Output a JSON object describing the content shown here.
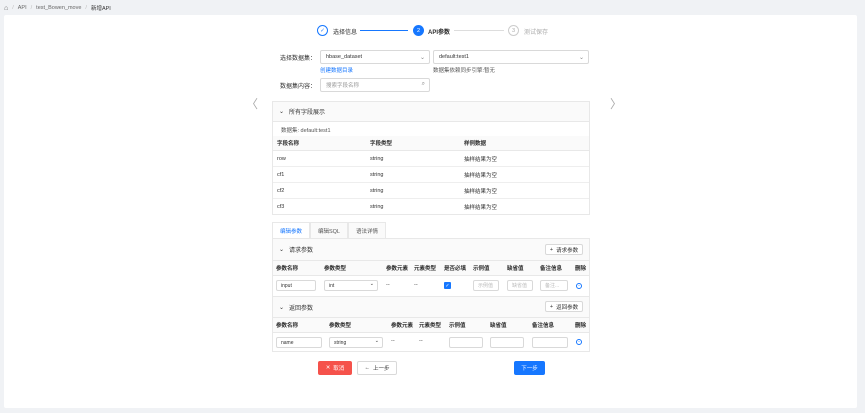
{
  "breadcrumb": {
    "items": [
      "API",
      "test_Bowen_move",
      "新增API"
    ]
  },
  "steps": [
    {
      "num": "✓",
      "label": "选择信息",
      "state": "done"
    },
    {
      "num": "2",
      "label": "API参数",
      "state": "active"
    },
    {
      "num": "3",
      "label": "测试保存",
      "state": "todo"
    }
  ],
  "form": {
    "dataset_label": "选择数据集：",
    "dataset_value": "hbase_dataset",
    "table_value": "default:test1",
    "create_link": "创建数据目录",
    "sync_hint": "数据集依赖同步引擎:暂无",
    "content_label": "数据集内容：",
    "search_placeholder": "搜索字段名称"
  },
  "fields_panel": {
    "title": "所有字段展示",
    "dataset_line": "数据集: default:test1",
    "columns": [
      "字段名称",
      "字段类型",
      "样例数据"
    ],
    "rows": [
      [
        "row",
        "string",
        "抽样结果为空"
      ],
      [
        "cf1",
        "string",
        "抽样结果为空"
      ],
      [
        "cf2",
        "string",
        "抽样结果为空"
      ],
      [
        "cf3",
        "string",
        "抽样结果为空"
      ]
    ]
  },
  "tabs": [
    "编辑参数",
    "编辑SQL",
    "语法详情"
  ],
  "request": {
    "title": "请求参数",
    "add_label": "请求参数",
    "columns": [
      "参数名称",
      "参数类型",
      "参数元素",
      "元素类型",
      "是否必填",
      "示例值",
      "缺省值",
      "备注信息",
      "删除"
    ],
    "row": {
      "name": "input",
      "type": "int",
      "elem": "--",
      "elem_type": "--",
      "example_ph": "示例值",
      "default_ph": "缺省值",
      "note_ph": "备注..."
    }
  },
  "response": {
    "title": "返回参数",
    "add_label": "返回参数",
    "columns": [
      "参数名称",
      "参数类型",
      "参数元素",
      "元素类型",
      "示例值",
      "缺省值",
      "备注信息",
      "删除"
    ],
    "row": {
      "name": "name",
      "type": "string",
      "elem": "--",
      "elem_type": "--"
    }
  },
  "footer": {
    "cancel": "取消",
    "prev": "上一步",
    "next": "下一步"
  },
  "colors": {
    "accent": "#1677ff",
    "danger": "#f5524b"
  }
}
